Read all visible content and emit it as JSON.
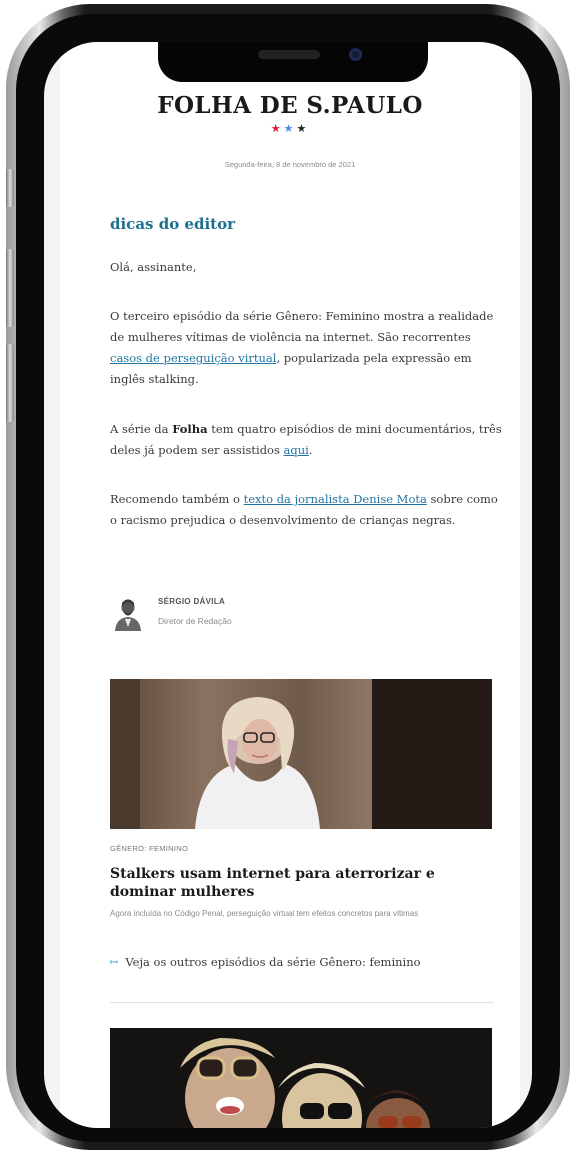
{
  "newsletter": {
    "brand": "FOLHA DE S.PAULO",
    "date": "Segunda-feira, 8 de novembro de 2021",
    "section_title": "dicas do editor",
    "greeting": "Olá, assinante,",
    "p1": {
      "before": "O terceiro episódio da série Gênero: Feminino mostra a realidade de mulheres vítimas de violência na internet. São recorrentes ",
      "link": "casos de perseguição virtual",
      "after": ", popularizada pela expressão em inglês stalking."
    },
    "p2": {
      "before": "A série da ",
      "bold": "Folha",
      "middle": " tem quatro episódios de mini documentários, três deles já podem ser assistidos ",
      "link": "aqui",
      "after": "."
    },
    "p3": {
      "before": "Recomendo também o ",
      "link": "texto da jornalista Denise Mota",
      "after": " sobre como o racismo prejudica o desenvolvimento de crianças negras."
    },
    "author": {
      "name": "SÉRGIO DÁVILA",
      "role": "Diretor de Redação"
    },
    "article": {
      "kicker": "GÊNERO: FEMININO",
      "headline": "Stalkers usam internet para aterrorizar e dominar mulheres",
      "dek": "Agora incluída no Código Penal, perseguição virtual tem efeitos concretos para vítimas",
      "more_link": "Veja os outros episódios da série Gênero: feminino"
    }
  },
  "colors": {
    "link": "#1f76a3",
    "section_title": "#1c6f8e",
    "star_red": "#d91f36",
    "star_blue": "#4c8fe0"
  }
}
